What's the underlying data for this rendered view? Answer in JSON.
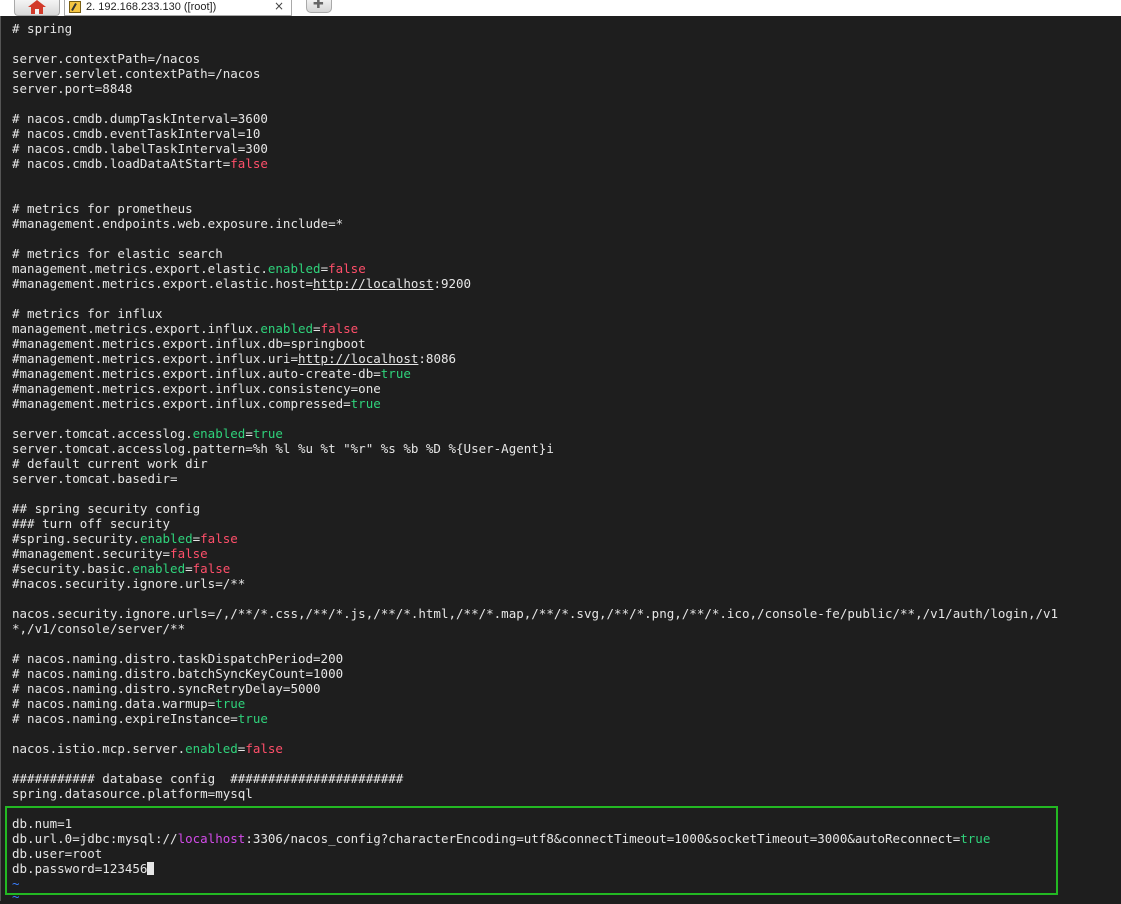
{
  "tabs": {
    "home_icon": "home-icon",
    "session_title": "2. 192.168.233.130 ([root])",
    "close_glyph": "×",
    "new_tab_glyph": "✚"
  },
  "colors": {
    "background": "#1e1e1e",
    "text": "#e6e6e6",
    "keyword": "#2fd27b",
    "boolean": "#ff4f6a",
    "host": "#d24be8",
    "highlight_border": "#23b823"
  },
  "terminal": {
    "l01": "# spring",
    "l02": "server.contextPath=/nacos",
    "l03": "server.servlet.contextPath=/nacos",
    "l04": "server.port=8848",
    "l05": "# nacos.cmdb.dumpTaskInterval=3600",
    "l06": "# nacos.cmdb.eventTaskInterval=10",
    "l07": "# nacos.cmdb.labelTaskInterval=300",
    "l08a": "# nacos.cmdb.loadDataAtStart=",
    "l08b": "false",
    "l09": "# metrics for prometheus",
    "l10": "#management.endpoints.web.exposure.include=*",
    "l11": "# metrics for elastic search",
    "l12a": "management.metrics.export.elastic.",
    "l12b": "enabled",
    "l12c": "=",
    "l12d": "false",
    "l13a": "#management.metrics.export.elastic.host=",
    "l13b": "http://localhost",
    "l13c": ":9200",
    "l14": "# metrics for influx",
    "l15a": "management.metrics.export.influx.",
    "l15b": "enabled",
    "l15c": "=",
    "l15d": "false",
    "l16": "#management.metrics.export.influx.db=springboot",
    "l17a": "#management.metrics.export.influx.uri=",
    "l17b": "http://localhost",
    "l17c": ":8086",
    "l18a": "#management.metrics.export.influx.auto-create-db=",
    "l18b": "true",
    "l19": "#management.metrics.export.influx.consistency=one",
    "l20a": "#management.metrics.export.influx.compressed=",
    "l20b": "true",
    "l21a": "server.tomcat.accesslog.",
    "l21b": "enabled",
    "l21c": "=",
    "l21d": "true",
    "l22": "server.tomcat.accesslog.pattern=%h %l %u %t \"%r\" %s %b %D %{User-Agent}i",
    "l23": "# default current work dir",
    "l24": "server.tomcat.basedir=",
    "l25": "## spring security config",
    "l26": "### turn off security",
    "l27a": "#spring.security.",
    "l27b": "enabled",
    "l27c": "=",
    "l27d": "false",
    "l28a": "#management.security=",
    "l28b": "false",
    "l29a": "#security.basic.",
    "l29b": "enabled",
    "l29c": "=",
    "l29d": "false",
    "l30": "#nacos.security.ignore.urls=/**",
    "l31": "nacos.security.ignore.urls=/,/**/*.css,/**/*.js,/**/*.html,/**/*.map,/**/*.svg,/**/*.png,/**/*.ico,/console-fe/public/**,/v1/auth/login,/v1",
    "l32": "*,/v1/console/server/**",
    "l33": "# nacos.naming.distro.taskDispatchPeriod=200",
    "l34": "# nacos.naming.distro.batchSyncKeyCount=1000",
    "l35": "# nacos.naming.distro.syncRetryDelay=5000",
    "l36a": "# nacos.naming.data.warmup=",
    "l36b": "true",
    "l37a": "# nacos.naming.expireInstance=",
    "l37b": "true",
    "l38a": "nacos.istio.mcp.server.",
    "l38b": "enabled",
    "l38c": "=",
    "l38d": "false",
    "l39": "########### database config  #######################",
    "l40": "spring.datasource.platform=mysql",
    "l41": "db.num=1",
    "l42a": "db.url.0=jdbc:mysql://",
    "l42b": "localhost",
    "l42c": ":3306/nacos_config?characterEncoding=utf8&connectTimeout=1000&socketTimeout=3000&autoReconnect=",
    "l42d": "true",
    "l43": "db.user=root",
    "l44": "db.password=123456",
    "tilde": "~"
  }
}
